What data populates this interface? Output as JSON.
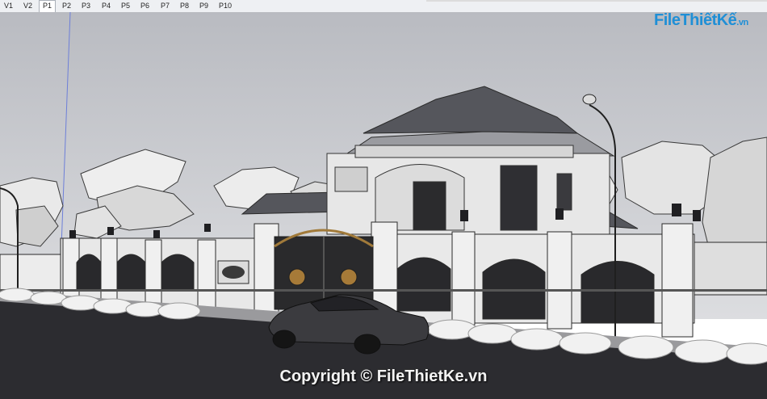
{
  "scene_tabs": [
    {
      "label": "V1",
      "active": false
    },
    {
      "label": "V2",
      "active": false
    },
    {
      "label": "P1",
      "active": true
    },
    {
      "label": "P2",
      "active": false
    },
    {
      "label": "P3",
      "active": false
    },
    {
      "label": "P4",
      "active": false
    },
    {
      "label": "P5",
      "active": false
    },
    {
      "label": "P6",
      "active": false
    },
    {
      "label": "P7",
      "active": false
    },
    {
      "label": "P8",
      "active": false
    },
    {
      "label": "P9",
      "active": false
    },
    {
      "label": "P10",
      "active": false
    }
  ],
  "watermark": {
    "logo_text": "FileThiếtKế",
    "logo_suffix": ".vn",
    "copyright": "Copyright © FileThietKe.vn"
  },
  "colors": {
    "sky": "#c9cbd0",
    "roof": "#55565c",
    "wall": "#e6e6e6",
    "road": "#2c2c30",
    "accent": "#1f8fd6"
  }
}
